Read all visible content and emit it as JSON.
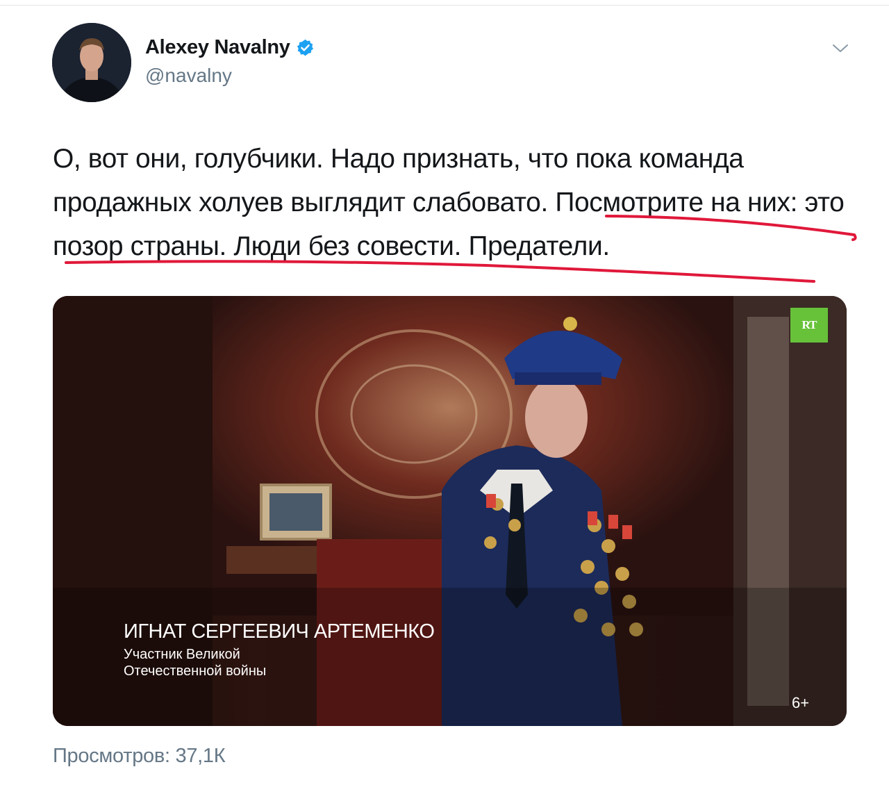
{
  "author": {
    "display_name": "Alexey Navalny",
    "handle": "@navalny",
    "verified": true
  },
  "tweet": {
    "text": "О, вот они, голубчики. Надо признать, что пока команда продажных холуев выглядит слабовато. Посмотрите на них: это позор страны. Люди без совести. Предатели."
  },
  "media": {
    "channel_logo": "RT",
    "caption_name": "ИГНАТ СЕРГЕЕВИЧ АРТЕМЕНКО",
    "caption_role": "Участник Великой Отечественной войны",
    "age_rating": "6+"
  },
  "views": "Просмотров: 37,1К",
  "icons": {
    "verified": "verified-badge-icon",
    "menu": "chevron-down-icon"
  },
  "colors": {
    "verified_blue": "#1da1f2",
    "handwritten_underline": "#e0183a",
    "rt_green": "#67c23a",
    "secondary_text": "#657786"
  }
}
